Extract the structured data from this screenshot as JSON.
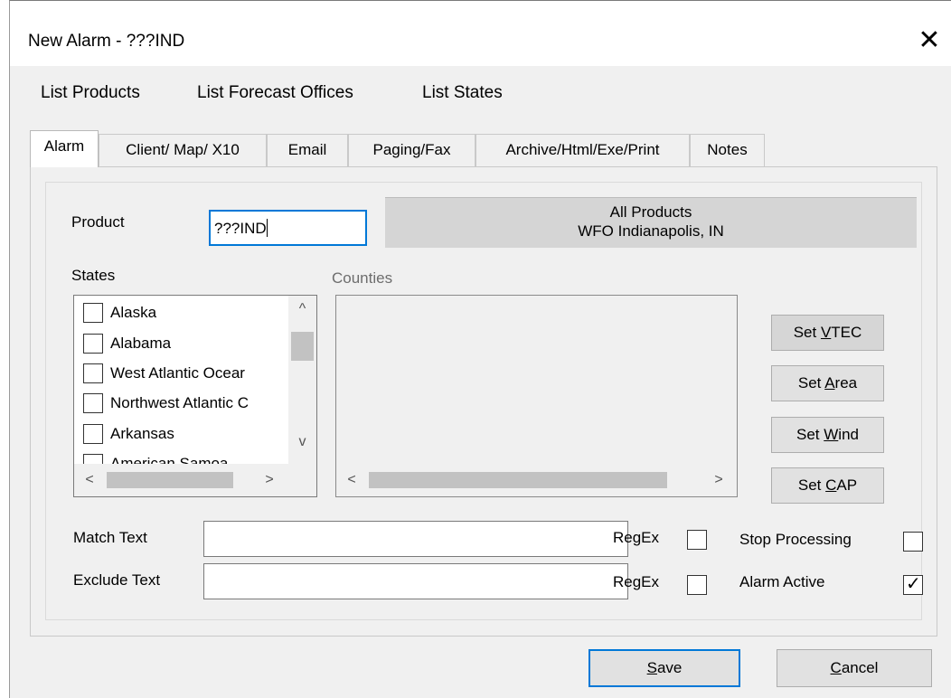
{
  "window": {
    "title": "New Alarm - ???IND",
    "close_glyph": "✕"
  },
  "menu": [
    "List Products",
    "List Forecast Offices",
    "List States"
  ],
  "tabs": [
    "Alarm",
    "Client/ Map/ X10",
    "Email",
    "Paging/Fax",
    "Archive/Html/Exe/Print",
    "Notes"
  ],
  "active_tab": "Alarm",
  "product": {
    "label": "Product",
    "value": "???IND",
    "info_line1": "All Products",
    "info_line2": "WFO Indianapolis, IN"
  },
  "states": {
    "label": "States",
    "items": [
      {
        "name": "Alaska",
        "checked": false
      },
      {
        "name": "Alabama",
        "checked": false
      },
      {
        "name": "West Atlantic Ocear",
        "checked": false
      },
      {
        "name": "Northwest Atlantic C",
        "checked": false
      },
      {
        "name": "Arkansas",
        "checked": false
      },
      {
        "name": "American Samoa",
        "checked": false
      }
    ]
  },
  "counties": {
    "label": "Counties"
  },
  "side_buttons": {
    "set_vtec": {
      "pre": "Set ",
      "key": "V",
      "post": "TEC"
    },
    "set_area": {
      "pre": "Set ",
      "key": "A",
      "post": "rea"
    },
    "set_wind": {
      "pre": "Set ",
      "key": "W",
      "post": "ind"
    },
    "set_cap": {
      "pre": "Set ",
      "key": "C",
      "post": "AP"
    }
  },
  "match": {
    "label": "Match Text",
    "value": "",
    "regex_label": "RegEx",
    "regex_checked": false
  },
  "exclude": {
    "label": "Exclude Text",
    "value": "",
    "regex_label": "RegEx",
    "regex_checked": false
  },
  "stop_processing": {
    "label": "Stop Processing",
    "checked": false
  },
  "alarm_active": {
    "label": "Alarm Active",
    "checked": true
  },
  "footer": {
    "save": {
      "key": "S",
      "post": "ave"
    },
    "cancel": {
      "key": "C",
      "post": "ancel"
    }
  },
  "icons": {
    "scroll_up": "^",
    "scroll_down": "v",
    "scroll_left": "<",
    "scroll_right": ">",
    "check": "✓"
  }
}
